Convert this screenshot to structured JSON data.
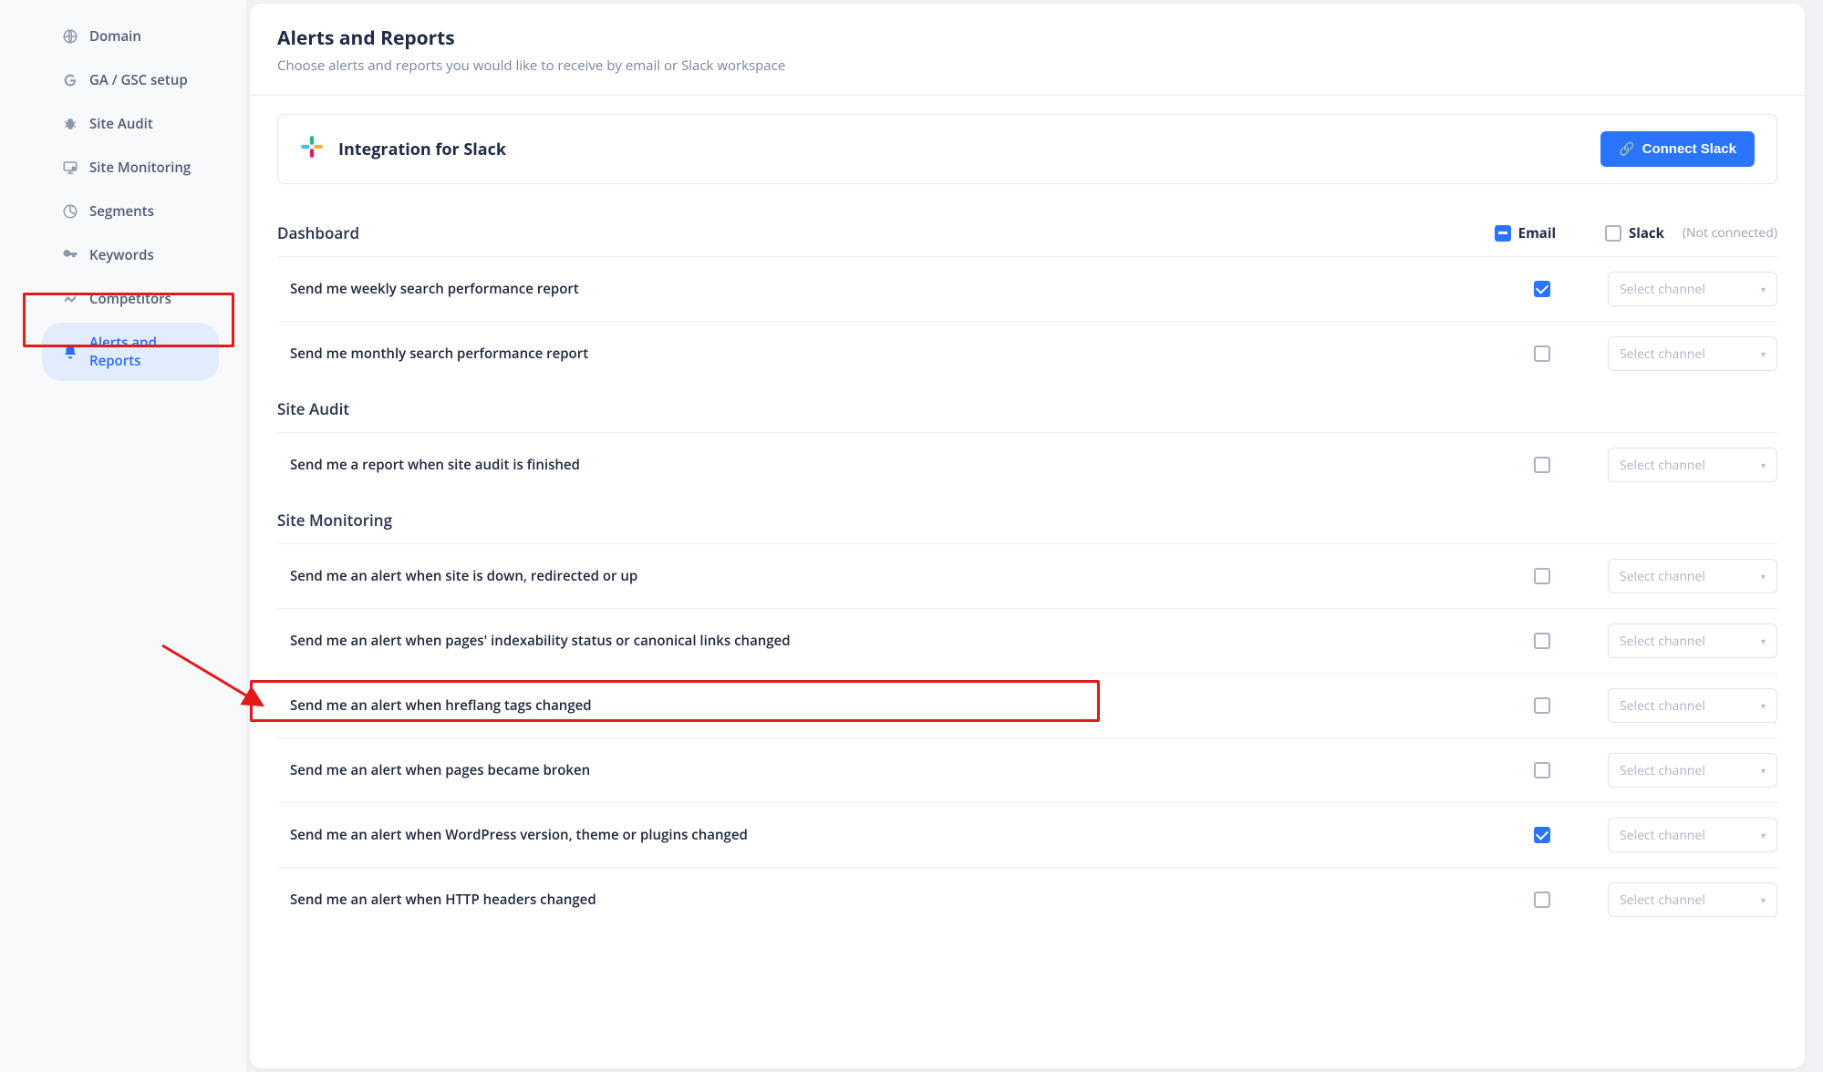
{
  "sidebar": {
    "items": [
      {
        "label": "Domain",
        "icon": "globe-icon",
        "active": false
      },
      {
        "label": "GA / GSC setup",
        "icon": "google-g-icon",
        "active": false
      },
      {
        "label": "Site Audit",
        "icon": "bug-icon",
        "active": false
      },
      {
        "label": "Site Monitoring",
        "icon": "monitor-icon",
        "active": false
      },
      {
        "label": "Segments",
        "icon": "segment-icon",
        "active": false
      },
      {
        "label": "Keywords",
        "icon": "key-icon",
        "active": false
      },
      {
        "label": "Competitors",
        "icon": "competitors-icon",
        "active": false
      },
      {
        "label": "Alerts and Reports",
        "icon": "bell-icon",
        "active": true
      }
    ]
  },
  "page": {
    "title": "Alerts and Reports",
    "subtitle": "Choose alerts and reports you would like to receive by email or Slack workspace"
  },
  "integration": {
    "title": "Integration for Slack",
    "button": "Connect Slack"
  },
  "columns": {
    "email": "Email",
    "slack": "Slack",
    "slack_note": "(Not connected)",
    "select_placeholder": "Select channel"
  },
  "sections": [
    {
      "title": "Dashboard",
      "show_column_headers": true,
      "rows": [
        {
          "label": "Send me weekly search performance report",
          "email_checked": true
        },
        {
          "label": "Send me monthly search performance report",
          "email_checked": false
        }
      ]
    },
    {
      "title": "Site Audit",
      "show_column_headers": false,
      "rows": [
        {
          "label": "Send me a report when site audit is finished",
          "email_checked": false
        }
      ]
    },
    {
      "title": "Site Monitoring",
      "show_column_headers": false,
      "rows": [
        {
          "label": "Send me an alert when site is down, redirected or up",
          "email_checked": false
        },
        {
          "label": "Send me an alert when pages' indexability status or canonical links changed",
          "email_checked": false
        },
        {
          "label": "Send me an alert when hreflang tags changed",
          "email_checked": false
        },
        {
          "label": "Send me an alert when pages became broken",
          "email_checked": false
        },
        {
          "label": "Send me an alert when WordPress version, theme or plugins changed",
          "email_checked": true
        },
        {
          "label": "Send me an alert when HTTP headers changed",
          "email_checked": false
        }
      ]
    }
  ]
}
